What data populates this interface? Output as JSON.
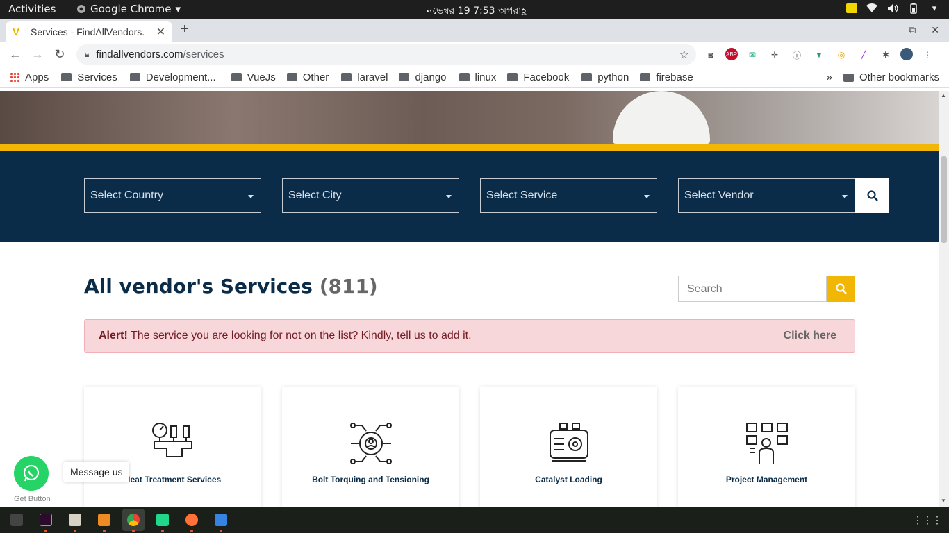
{
  "system_bar": {
    "activities": "Activities",
    "app_name": "Google Chrome",
    "clock": "নভেম্বর 19  7:53 অপরাহ্ণ"
  },
  "tab": {
    "title": "Services - FindAllVendors.",
    "close": "✕",
    "new_tab": "+"
  },
  "window_controls": {
    "minimize": "–",
    "restore": "⧉",
    "close": "✕"
  },
  "omnibox": {
    "domain": "findallvendors.com",
    "path": "/services"
  },
  "extensions": [
    "camera-icon",
    "abp-icon",
    "mail-icon",
    "move-icon",
    "code-icon",
    "vue-icon",
    "chrome-ext-icon",
    "pen-icon",
    "puzzle-icon",
    "profile-icon",
    "menu-icon"
  ],
  "extension_labels": {
    "abp": "ABP"
  },
  "bookmarks": {
    "apps": "Apps",
    "items": [
      "Services",
      "Development...",
      "VueJs",
      "Other",
      "laravel",
      "django",
      "linux",
      "Facebook",
      "python",
      "firebase"
    ],
    "overflow": "»",
    "other": "Other bookmarks"
  },
  "filters": {
    "country": "Select Country",
    "city": "Select City",
    "service": "Select Service",
    "vendor": "Select Vendor"
  },
  "heading": {
    "title": "All vendor's Services",
    "count": "(811)"
  },
  "search": {
    "placeholder": "Search"
  },
  "alert": {
    "strong": "Alert!",
    "text": " The service you are looking for not on the list? Kindly, tell us to add it.",
    "link": "Click here"
  },
  "cards": [
    {
      "label": "Heat Treatment Services",
      "icon": "heat-treatment-icon"
    },
    {
      "label": "Bolt Torquing and Tensioning",
      "icon": "bolt-gear-icon"
    },
    {
      "label": "Catalyst Loading",
      "icon": "catalyst-machine-icon"
    },
    {
      "label": "Project Management",
      "icon": "project-management-icon"
    }
  ],
  "whatsapp": {
    "message": "Message us",
    "get_button": "Get Button"
  },
  "colors": {
    "navy": "#0a2c48",
    "accent_yellow": "#f2b705",
    "alert_bg": "#f8d7da",
    "whatsapp_green": "#25d366"
  }
}
